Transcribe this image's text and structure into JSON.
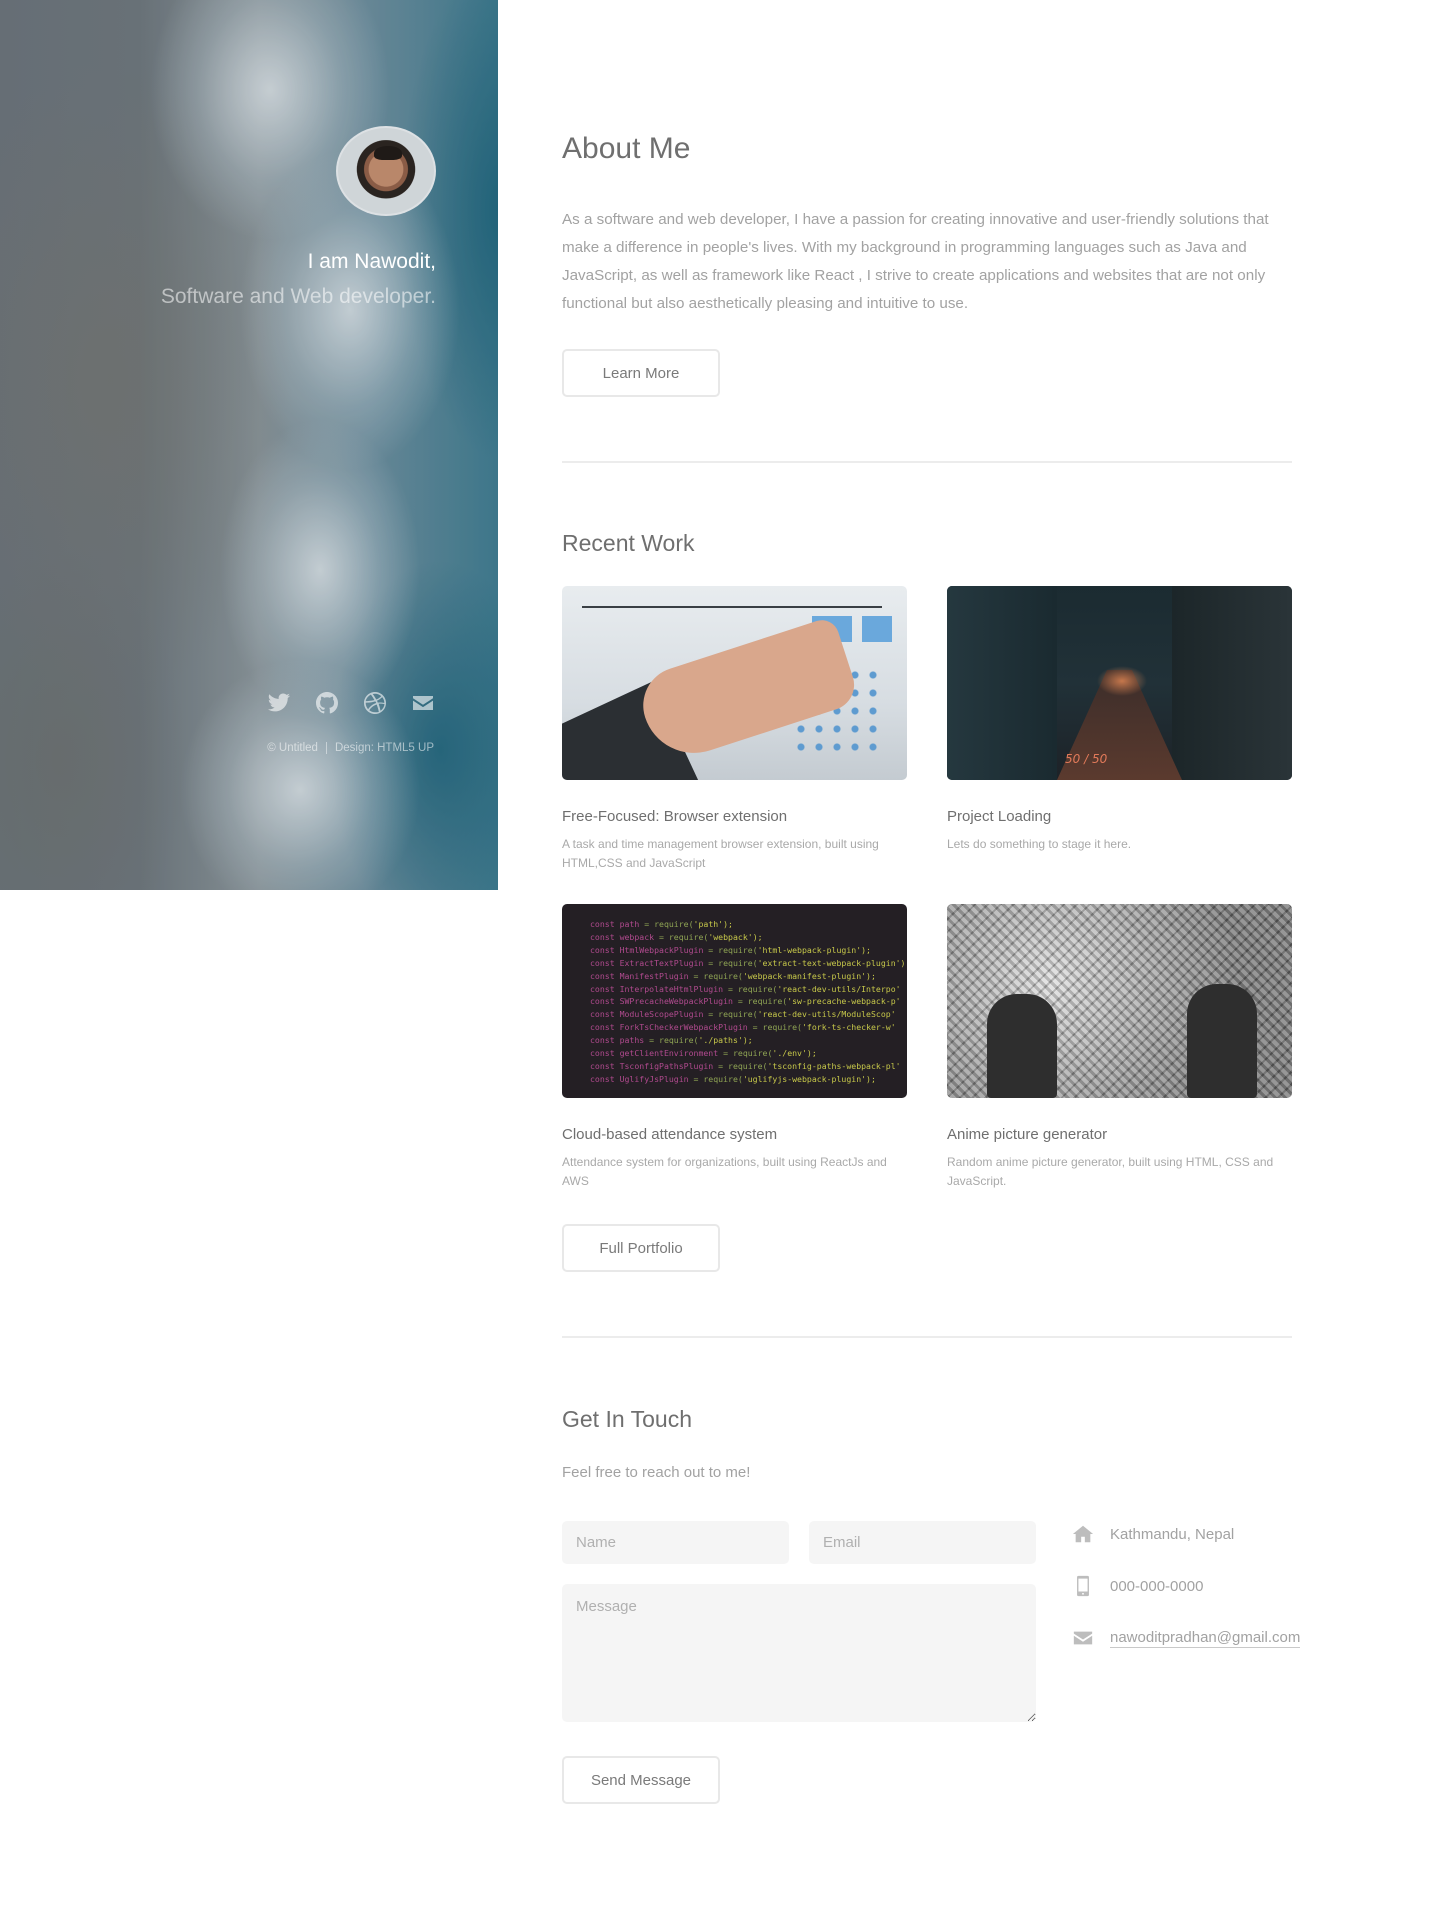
{
  "sidebar": {
    "greeting": "I am Nawodit,",
    "role": "Software and Web developer.",
    "socials": [
      {
        "icon": "twitter-icon"
      },
      {
        "icon": "github-icon"
      },
      {
        "icon": "dribbble-icon"
      },
      {
        "icon": "envelope-icon"
      }
    ],
    "copyright": "© Untitled",
    "design_credit": "Design: HTML5 UP"
  },
  "about": {
    "title": "About Me",
    "text": "As a software and web developer, I have a passion for creating innovative and user-friendly solutions that make a difference in people's lives. With my background in programming languages such as Java and JavaScript, as well as framework like React , I strive to create applications and websites that are not only functional but also aesthetically pleasing and intuitive to use.",
    "button": "Learn More"
  },
  "work": {
    "title": "Recent Work",
    "items": [
      {
        "title": "Free-Focused: Browser extension",
        "description": "A task and time management browser extension, built using HTML,CSS and JavaScript"
      },
      {
        "title": "Project Loading",
        "description": "Lets do something to stage it here."
      },
      {
        "title": "Cloud-based attendance system",
        "description": "Attendance system for organizations, built using ReactJs and AWS"
      },
      {
        "title": "Anime picture generator",
        "description": "Random anime picture generator, built using HTML, CSS and JavaScript."
      }
    ],
    "thumb_text": {
      "city_mark": "50 / 50"
    },
    "button": "Full Portfolio"
  },
  "contact": {
    "title": "Get In Touch",
    "subtitle": "Feel free to reach out to me!",
    "form": {
      "name_placeholder": "Name",
      "email_placeholder": "Email",
      "message_placeholder": "Message",
      "submit": "Send Message"
    },
    "info": {
      "address": "Kathmandu, Nepal",
      "phone": "000-000-0000",
      "email": "nawoditpradhan@gmail.com"
    }
  }
}
